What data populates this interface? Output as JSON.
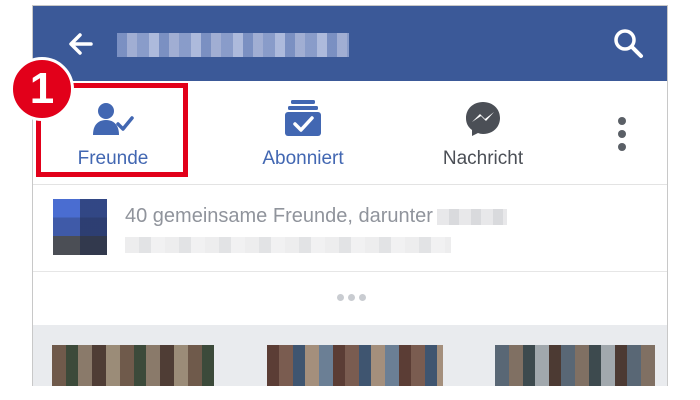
{
  "header": {
    "back_icon": "arrow-left-icon",
    "search_icon": "search-icon",
    "bar_color": "#3b5998"
  },
  "actions": [
    {
      "label": "Freunde",
      "icon": "friends-check-icon",
      "color": "#4267b2"
    },
    {
      "label": "Abonniert",
      "icon": "subscribed-icon",
      "color": "#4267b2"
    },
    {
      "label": "Nachricht",
      "icon": "messenger-icon",
      "color": "#4b4f56"
    }
  ],
  "more_icon": "more-vertical-icon",
  "annotation": {
    "number": "1",
    "color": "#e2001a"
  },
  "mutual_friends": {
    "text": "40 gemeinsame Freunde, darunter"
  }
}
